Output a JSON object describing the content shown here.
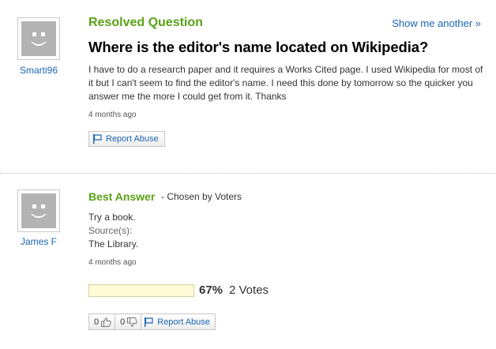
{
  "question": {
    "asker": "Smarti96",
    "status_label": "Resolved Question",
    "show_another": "Show me another »",
    "title": "Where is the editor's name located on Wikipedia?",
    "body": "I have to do a research paper and it requires a Works Cited page. I used Wikipedia for most of it but I can't seem to find the editor's name. I need this done by tomorrow so the quicker you answer me the more I could get from it. Thanks",
    "time": "4 months ago",
    "report_label": "Report Abuse"
  },
  "answer": {
    "answerer": "James F",
    "best_label": "Best Answer",
    "chosen_text": "- Chosen by Voters",
    "text": "Try a book.",
    "sources_label": "Source(s):",
    "source": "The Library.",
    "time": "4 months ago",
    "vote_fraction": 0.67,
    "vote_percent": "67%",
    "vote_count": "2 Votes",
    "thumbs_up_count": "0",
    "thumbs_down_count": "0",
    "report_label": "Report Abuse"
  },
  "icons": {
    "avatar": "default-avatar-icon",
    "flag": "flag-icon",
    "thumbs_up": "thumbs-up-icon",
    "thumbs_down": "thumbs-down-icon"
  },
  "colors": {
    "accent_green": "#5aa117",
    "link_blue": "#1a66b3",
    "vote_bar": "#fefbd6"
  }
}
